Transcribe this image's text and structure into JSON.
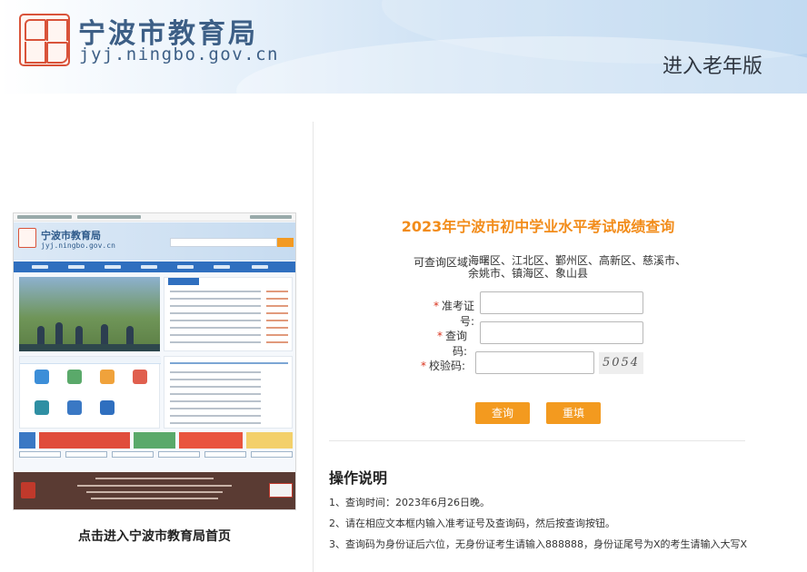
{
  "header": {
    "site_title": "宁波市教育局",
    "site_url": "jyj.ningbo.gov.cn",
    "elder_mode_link": "进入老年版"
  },
  "left": {
    "thumbnail_site_title": "宁波市教育局",
    "thumbnail_site_url": "jyj.ningbo.gov.cn",
    "home_link_caption": "点击进入宁波市教育局首页"
  },
  "form": {
    "title": "2023年宁波市初中学业水平考试成绩查询",
    "region_label": "可查询区域:",
    "region_text": "海曙区、江北区、鄞州区、高新区、慈溪市、余姚市、镇海区、象山县",
    "required_mark": "*",
    "exam_number_label": "准考证号:",
    "exam_number_value": "",
    "query_code_label": "查询码:",
    "query_code_value": "",
    "verify_code_label": "校验码:",
    "verify_code_value": "",
    "captcha_text": "5054",
    "query_button": "查询",
    "reset_button": "重填"
  },
  "instructions": {
    "title": "操作说明",
    "items": [
      "1、查询时间：2023年6月26日晚。",
      "2、请在相应文本框内输入准考证号及查询码，然后按查询按钮。",
      "3、查询码为身份证后六位，无身份证考生请输入888888，身份证尾号为X的考生请输入大写X"
    ]
  },
  "colors": {
    "accent_orange": "#f39a1f",
    "title_orange": "#f28c1a",
    "header_blue": "#3d5f86",
    "required_red": "#d9331c"
  }
}
